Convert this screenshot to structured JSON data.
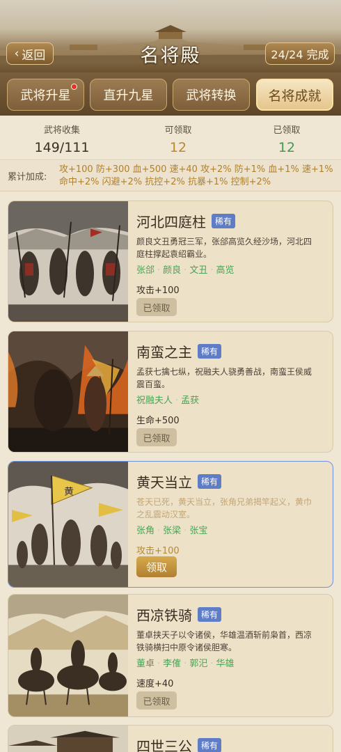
{
  "header": {
    "back_label": "返回",
    "title": "名将殿",
    "progress": "24/24 完成"
  },
  "tabs": [
    {
      "label": "武将升星",
      "has_dot": true
    },
    {
      "label": "直升九星",
      "has_dot": false
    },
    {
      "label": "武将转换",
      "has_dot": false
    },
    {
      "label": "名将成就",
      "active": true
    }
  ],
  "stats": {
    "collection_label": "武将收集",
    "collection_value": "149/111",
    "claimable_label": "可领取",
    "claimable_value": "12",
    "claimed_label": "已领取",
    "claimed_value": "12"
  },
  "bonus": {
    "label": "累计加成:",
    "text": "攻+100 防+300 血+500 速+40 攻+2% 防+1% 血+1% 速+1% 命中+2% 闪避+2% 抗控+2% 抗暴+1% 控制+2%"
  },
  "cards": [
    {
      "name": "河北四庭柱",
      "tag": "稀有",
      "desc": "颜良文丑勇冠三军，张郃高览久经沙场，河北四庭柱撑起袁绍霸业。",
      "heroes": [
        "张郃",
        "颜良",
        "文丑",
        "高览"
      ],
      "reward": "攻击+100",
      "button": "已领取"
    },
    {
      "name": "南蛮之主",
      "tag": "稀有",
      "desc": "孟获七擒七纵，祝融夫人骁勇善战，南蛮王侯威震百蛮。",
      "heroes": [
        "祝融夫人",
        "孟获"
      ],
      "reward": "生命+500",
      "button": "已领取"
    },
    {
      "name": "黄天当立",
      "tag": "稀有",
      "desc": "苍天已死，黄天当立，张角兄弟揭竿起义，黄巾之乱震动汉室。",
      "heroes": [
        "张角",
        "张梁",
        "张宝"
      ],
      "reward": "攻击+100",
      "button": "领取",
      "flag_char": "黄"
    },
    {
      "name": "西凉铁骑",
      "tag": "稀有",
      "desc": "董卓挟天子以令诸侯，华雄温酒斩前枭首，西凉铁骑横扫中原令诸侯胆寒。",
      "heroes": [
        "董卓",
        "李傕",
        "郭汜",
        "华雄"
      ],
      "reward": "速度+40",
      "button": "已领取"
    },
    {
      "name": "四世三公",
      "tag": "稀有"
    }
  ],
  "colors": {
    "accent_gold": "#b8892a",
    "green": "#3f9b4e",
    "rare_tag": "#5f7dc6",
    "selected_border": "#6f8fe0"
  }
}
